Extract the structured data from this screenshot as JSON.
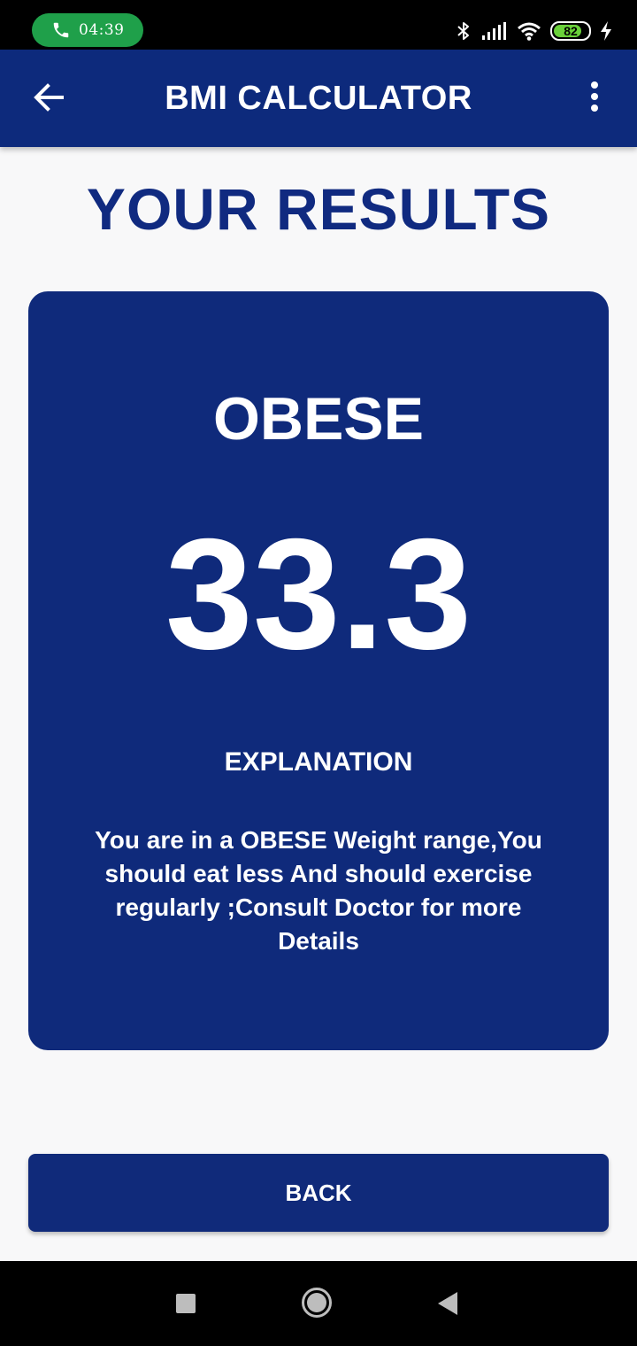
{
  "status_bar": {
    "time": "04:39",
    "battery_percent": "82",
    "battery_level": 0.82,
    "icons": [
      "phone-icon",
      "bluetooth-icon",
      "signal-icon",
      "wifi-icon",
      "battery-icon",
      "charging-icon"
    ]
  },
  "app_bar": {
    "title": "BMI CALCULATOR",
    "back_icon": "arrow-left-icon",
    "menu_icon": "more-vert-icon"
  },
  "results": {
    "heading": "YOUR RESULTS",
    "category": "OBESE",
    "bmi_value": "33.3",
    "explanation_label": "EXPLANATION",
    "explanation_text": "You are in a OBESE Weight range,You should eat less And should exercise regularly ;Consult Doctor for more Details"
  },
  "actions": {
    "back_label": "BACK"
  },
  "nav_bar": {
    "icons": [
      "recent-apps-icon",
      "home-icon",
      "back-triangle-icon"
    ]
  },
  "colors": {
    "primary": "#0d2a7c",
    "background": "#f8f8f9",
    "call_pill": "#1fa04a",
    "battery": "#6ad13a"
  }
}
